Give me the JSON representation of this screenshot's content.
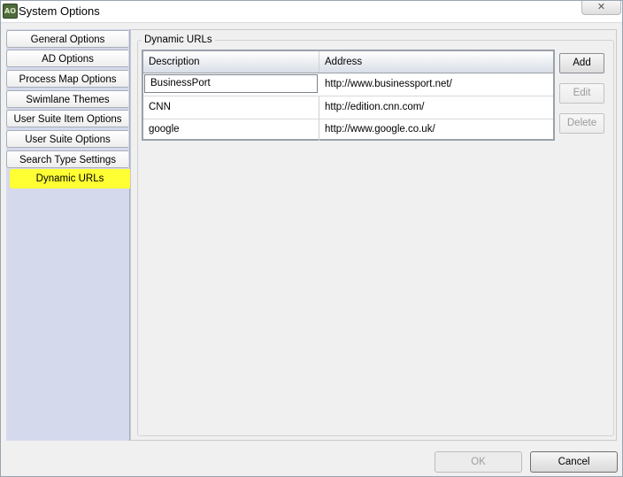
{
  "window": {
    "title": "System Options",
    "icon": "AO",
    "close_glyph": "✕"
  },
  "sidebar": {
    "tabs": [
      {
        "label": "General Options"
      },
      {
        "label": "AD Options"
      },
      {
        "label": "Process Map Options"
      },
      {
        "label": "Swimlane Themes"
      },
      {
        "label": "User Suite Item Options"
      },
      {
        "label": "User Suite Options"
      },
      {
        "label": "Search Type Settings"
      },
      {
        "label": "Dynamic URLs",
        "selected": true
      }
    ],
    "selected_color": "#ffff33"
  },
  "panel": {
    "group_label": "Dynamic URLs",
    "table": {
      "columns": [
        "Description",
        "Address"
      ],
      "rows": [
        {
          "description": "BusinessPort",
          "address": "http://www.businessport.net/"
        },
        {
          "description": "CNN",
          "address": "http://edition.cnn.com/"
        },
        {
          "description": "google",
          "address": "http://www.google.co.uk/"
        }
      ]
    },
    "buttons": {
      "add": "Add",
      "edit": "Edit",
      "delete": "Delete"
    }
  },
  "footer": {
    "ok": "OK",
    "cancel": "Cancel"
  }
}
